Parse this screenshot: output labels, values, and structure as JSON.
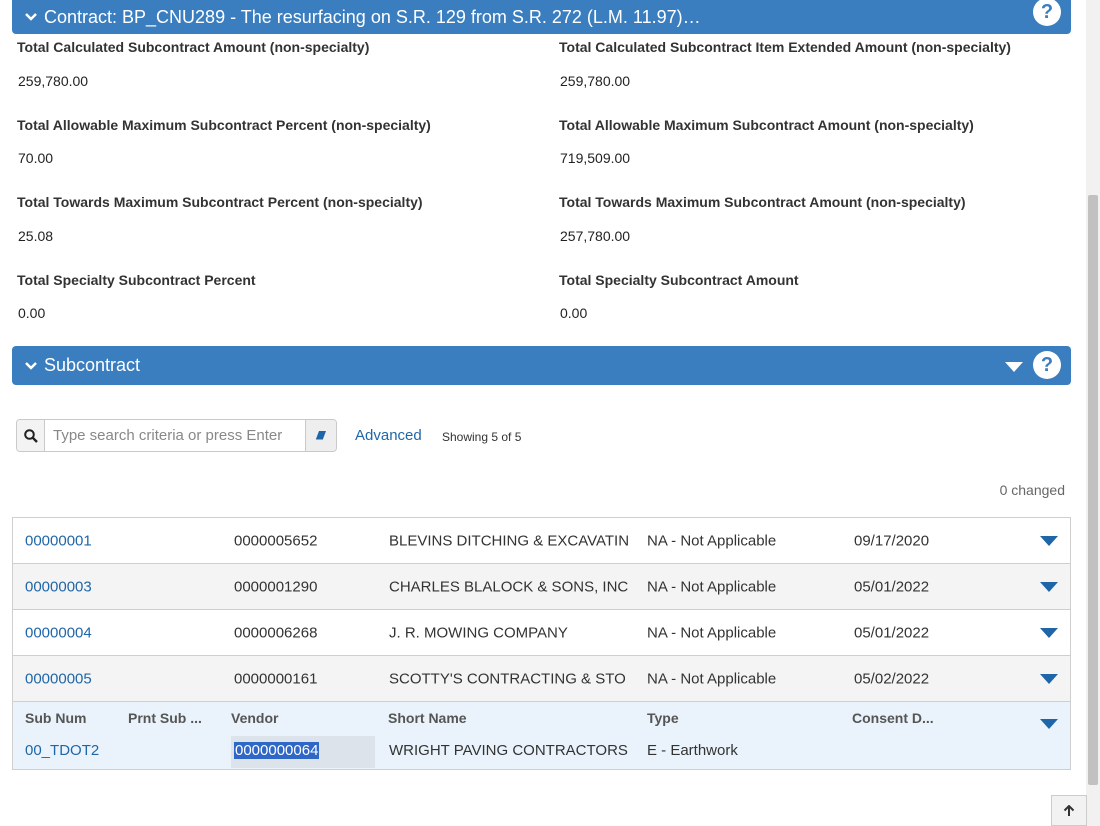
{
  "contract_panel": {
    "title": "Contract: BP_CNU289 - The resurfacing on S.R. 129 from S.R. 272 (L.M. 11.97)…",
    "help": "?"
  },
  "summary_fields": [
    {
      "label": "Total Calculated Subcontract Amount (non-specialty)",
      "value": "259,780.00"
    },
    {
      "label": "Total Calculated Subcontract Item Extended Amount (non-specialty)",
      "value": "259,780.00"
    },
    {
      "label": "Total Allowable Maximum Subcontract Percent (non-specialty)",
      "value": "70.00"
    },
    {
      "label": "Total Allowable Maximum Subcontract Amount (non-specialty)",
      "value": "719,509.00"
    },
    {
      "label": "Total Towards Maximum Subcontract Percent (non-specialty)",
      "value": "25.08"
    },
    {
      "label": "Total Towards Maximum Subcontract Amount (non-specialty)",
      "value": "257,780.00"
    },
    {
      "label": "Total Specialty Subcontract Percent",
      "value": "0.00"
    },
    {
      "label": "Total Specialty Subcontract Amount",
      "value": "0.00"
    }
  ],
  "subcontract_panel": {
    "title": "Subcontract",
    "help": "?"
  },
  "search": {
    "placeholder": "Type search criteria or press Enter",
    "advanced_label": "Advanced",
    "showing": "Showing 5 of 5",
    "changed": "0 changed"
  },
  "rows": [
    {
      "sub_num": "00000001",
      "vendor": "0000005652",
      "short_name": "BLEVINS DITCHING & EXCAVATIN",
      "type": "NA - Not Applicable",
      "consent_date": "09/17/2020"
    },
    {
      "sub_num": "00000003",
      "vendor": "0000001290",
      "short_name": "CHARLES BLALOCK & SONS, INC",
      "type": "NA - Not Applicable",
      "consent_date": "05/01/2022"
    },
    {
      "sub_num": "00000004",
      "vendor": "0000006268",
      "short_name": "J. R. MOWING COMPANY",
      "type": "NA - Not Applicable",
      "consent_date": "05/01/2022"
    },
    {
      "sub_num": "00000005",
      "vendor": "0000000161",
      "short_name": "SCOTTY'S CONTRACTING & STO",
      "type": "NA - Not Applicable",
      "consent_date": "05/02/2022"
    }
  ],
  "edit_row": {
    "headers": {
      "sub_num": "Sub Num",
      "prnt_sub": "Prnt Sub ...",
      "vendor": "Vendor",
      "short_name": "Short Name",
      "type": "Type",
      "consent": "Consent D..."
    },
    "sub_num": "00_TDOT2",
    "vendor": "0000000064",
    "short_name": "WRIGHT PAVING CONTRACTORS",
    "type": "E - Earthwork"
  },
  "colors": {
    "header_blue": "#3a7ebf",
    "link_blue": "#1f66a8",
    "selection": "#2f67c7"
  }
}
